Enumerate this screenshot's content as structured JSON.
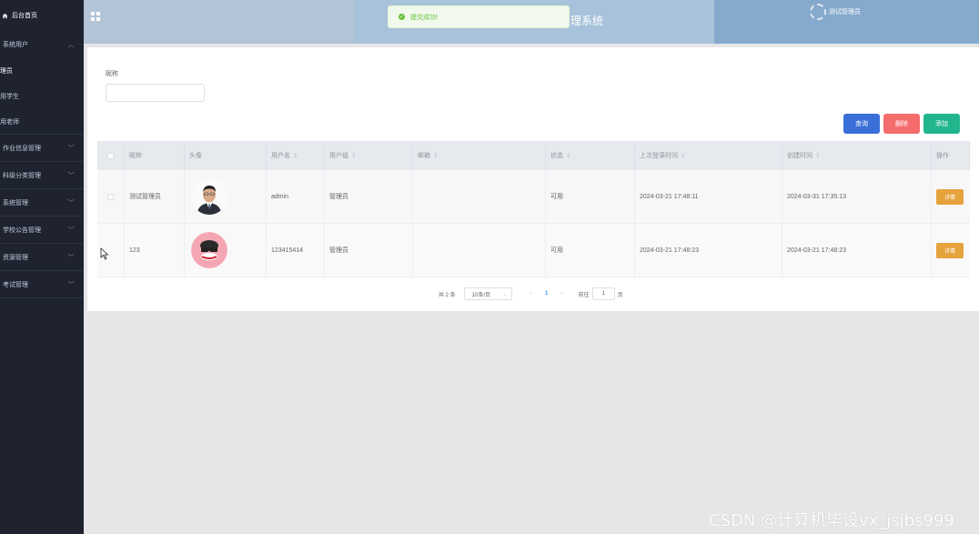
{
  "sidebar": {
    "home": "后台首页",
    "groups": [
      {
        "label": "系统用户",
        "expanded": true,
        "items": [
          "理员",
          "用学生",
          "用老师"
        ]
      },
      {
        "label": "作业信息管理"
      },
      {
        "label": "科级分类管理"
      },
      {
        "label": "系统管理"
      },
      {
        "label": "学校公告管理"
      },
      {
        "label": "资源管理"
      },
      {
        "label": "考试管理"
      }
    ]
  },
  "header": {
    "title": "理系统",
    "user": "测试管理员"
  },
  "toast": {
    "message": "提交成功!"
  },
  "search": {
    "label": "昵称",
    "value": "",
    "query_label": "查询",
    "delete_label": "删除",
    "add_label": "添加"
  },
  "table": {
    "headers": [
      "昵称",
      "头像",
      "用户名",
      "用户组",
      "邮箱",
      "状态",
      "上次登录时间",
      "创建时间",
      "操作"
    ],
    "rows": [
      {
        "nickname": "测试管理员",
        "username": "admin",
        "group": "管理员",
        "email": "",
        "status": "可用",
        "last_login": "2024-03-21 17:48:11",
        "created": "2024-03-31 17:35:13",
        "action": "详情"
      },
      {
        "nickname": "123",
        "username": "123415414",
        "group": "管理员",
        "email": "",
        "status": "可用",
        "last_login": "2024-03-21 17:48:23",
        "created": "2024-03-21 17:48:23",
        "action": "详情"
      }
    ]
  },
  "pager": {
    "total": "共 2 条",
    "page_size": "10条/页",
    "current_page": "1",
    "goto_label": "前往",
    "goto_value": "1",
    "page_suffix": "页"
  },
  "watermark": "CSDN @计算机毕设vx_jsjbs999",
  "colors": {
    "sidebar_bg": "#1f2330",
    "primary": "#3a6fd8",
    "danger": "#f56c6c",
    "success": "#20b58c",
    "warning": "#e6a23c",
    "toast_green": "#67c23a"
  }
}
